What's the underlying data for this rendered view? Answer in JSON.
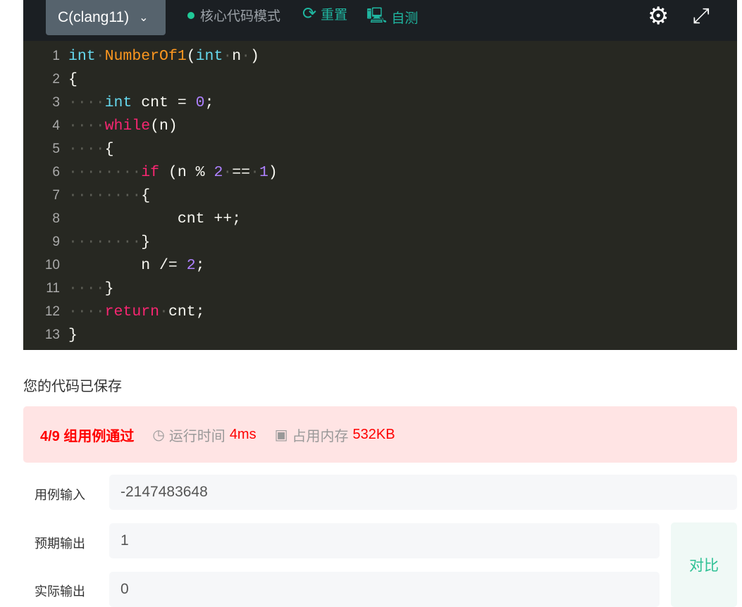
{
  "toolbar": {
    "language": "C(clang11)",
    "mode": "核心代码模式",
    "reset": "重置",
    "self_test": "自测"
  },
  "code": [
    [
      [
        "int",
        "type"
      ],
      " ",
      [
        "NumberOf1",
        "fn"
      ],
      "(",
      [
        "int",
        "type"
      ],
      " n ",
      ")"
    ],
    [
      "{"
    ],
    [
      "    ",
      [
        "int",
        "type"
      ],
      " cnt = ",
      [
        "0",
        "num"
      ],
      ";"
    ],
    [
      "    ",
      [
        "while",
        "kw"
      ],
      "(n)"
    ],
    [
      "    {"
    ],
    [
      "        ",
      [
        "if",
        "kw"
      ],
      " (n % ",
      [
        "2",
        "num"
      ],
      " == ",
      [
        "1",
        "num"
      ],
      ")"
    ],
    [
      "        {"
    ],
    [
      "            cnt ++;"
    ],
    [
      "        }"
    ],
    [
      "        n /= ",
      [
        "2",
        "num"
      ],
      ";"
    ],
    [
      "    }"
    ],
    [
      "    ",
      [
        "return",
        "kw"
      ],
      " cnt;"
    ],
    [
      "}"
    ]
  ],
  "status": {
    "saved": "您的代码已保存"
  },
  "result": {
    "pass": "4/9 组用例通过",
    "time_label": "运行时间",
    "time": "4ms",
    "mem_label": "占用内存",
    "mem": "532KB"
  },
  "case": {
    "input_label": "用例输入",
    "input": "-2147483648",
    "expected_label": "预期输出",
    "expected": "1",
    "actual_label": "实际输出",
    "actual": "0",
    "compare": "对比"
  }
}
